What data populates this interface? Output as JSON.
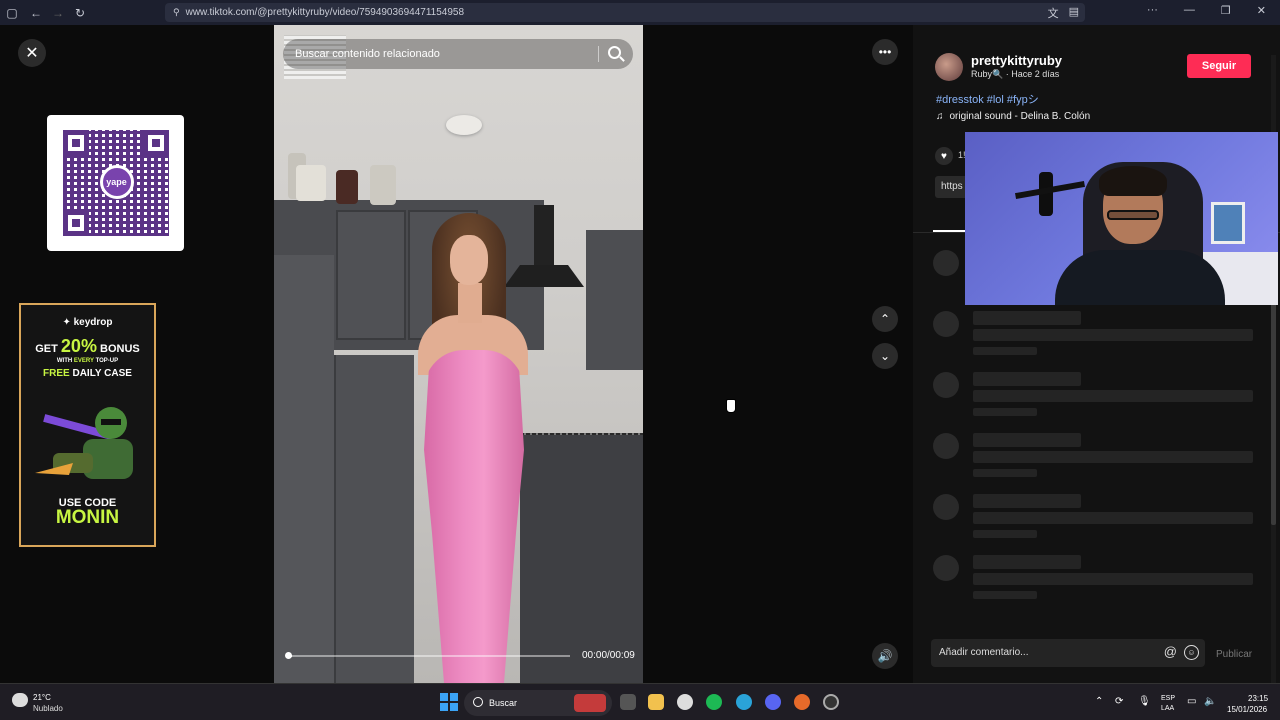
{
  "browser": {
    "url": "www.tiktok.com/@prettykittyruby/video/7594903694471154958"
  },
  "search": {
    "placeholder": "Buscar contenido relacionado"
  },
  "video": {
    "time": "00:00/00:09",
    "progress_fraction": 0.02
  },
  "ad": {
    "brand": "keydrop",
    "line1_prefix": "GET",
    "line1_value": "20%",
    "line1_suffix": "BONUS",
    "line2_prefix": "WITH",
    "line2_highlight": "EVERY",
    "line2_suffix": "TOP-UP",
    "line3_highlight": "FREE",
    "line3_suffix": "DAILY CASE",
    "use_code": "USE CODE",
    "code": "MONIN"
  },
  "qr": {
    "logo_text": "yape"
  },
  "post": {
    "username": "prettykittyruby",
    "sub_info": "Ruby🔍 · Hace 2 días",
    "follow_label": "Seguir",
    "hashtags": "#dresstok #lol #fypシ",
    "music": "original sound - Delina B. Colón",
    "like_count": "1!",
    "link_text": "https"
  },
  "comment": {
    "placeholder": "Añadir comentario...",
    "publish_label": "Publicar"
  },
  "taskbar": {
    "weather_temp": "21°C",
    "weather_desc": "Nublado",
    "search_label": "Buscar",
    "lang_line1": "ESP",
    "lang_line2": "LAA",
    "time": "23:15",
    "date": "15/01/2026"
  },
  "colors": {
    "follow_button": "#fe2c55",
    "hashtag": "#8ab4f8",
    "ad_accent": "#c7f542"
  }
}
